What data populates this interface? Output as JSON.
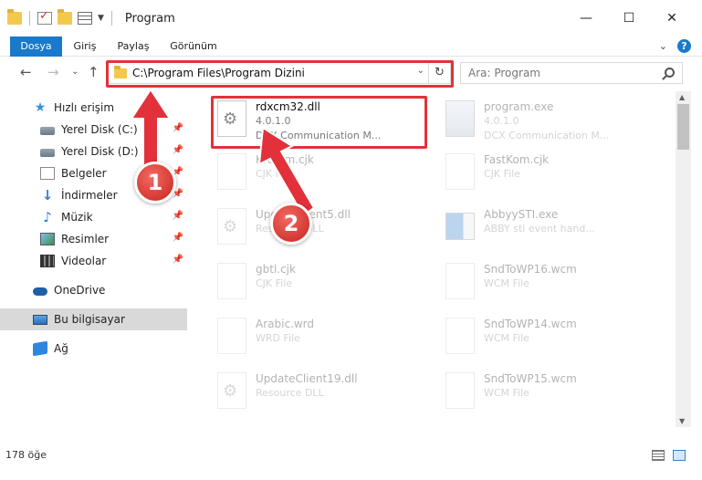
{
  "window": {
    "title": "Program",
    "minimize": "—",
    "maximize": "☐",
    "close": "✕"
  },
  "ribbon": {
    "tabs": [
      "Dosya",
      "Giriş",
      "Paylaş",
      "Görünüm"
    ],
    "help": "?",
    "collapse": "⌄"
  },
  "address": {
    "path": "C:\\Program Files\\Program Dizini",
    "dropdown": "⌄",
    "refresh": "↻",
    "back": "←",
    "forward": "→",
    "recent": "⌄",
    "up": "↑"
  },
  "search": {
    "placeholder": "Ara: Program"
  },
  "nav": {
    "items": [
      {
        "label": "Hızlı erişim",
        "icon": "star-icon"
      },
      {
        "label": "Yerel Disk (C:)",
        "icon": "disk-icon",
        "pinned": true
      },
      {
        "label": "Yerel Disk (D:)",
        "icon": "disk-icon",
        "pinned": true
      },
      {
        "label": "Belgeler",
        "icon": "documents-icon",
        "pinned": true
      },
      {
        "label": "İndirmeler",
        "icon": "downloads-icon",
        "pinned": true
      },
      {
        "label": "Müzik",
        "icon": "music-icon",
        "pinned": true
      },
      {
        "label": "Resimler",
        "icon": "pictures-icon",
        "pinned": true
      },
      {
        "label": "Videolar",
        "icon": "videos-icon",
        "pinned": true
      },
      {
        "label": "OneDrive",
        "icon": "onedrive-icon"
      },
      {
        "label": "Bu bilgisayar",
        "icon": "this-pc-icon",
        "selected": true
      },
      {
        "label": "Ağ",
        "icon": "network-icon"
      }
    ],
    "pin_glyph": "📌"
  },
  "files": [
    {
      "name": "rdxcm32.dll",
      "line1": "4.0.1.0",
      "line2": "DCX Communication M...",
      "icon": "dll-gear-icon",
      "highlighted": true
    },
    {
      "name": "program.exe",
      "line1": "4.0.1.0",
      "line2": "DCX Communication M...",
      "icon": "exe-icon"
    },
    {
      "name": "Krtcom.cjk",
      "line1": "CJK File",
      "line2": "",
      "icon": "file-icon"
    },
    {
      "name": "FastKom.cjk",
      "line1": "CJK File",
      "line2": "",
      "icon": "file-icon"
    },
    {
      "name": "UpdateClient5.dll",
      "line1": "Resource DLL",
      "line2": "",
      "icon": "dll-gear-icon"
    },
    {
      "name": "AbbyySTI.exe",
      "line1": "ABBY sti event hand...",
      "line2": "",
      "icon": "app-icon"
    },
    {
      "name": "gbtl.cjk",
      "line1": "CJK File",
      "line2": "",
      "icon": "file-icon"
    },
    {
      "name": "SndToWP16.wcm",
      "line1": "WCM File",
      "line2": "",
      "icon": "file-icon"
    },
    {
      "name": "Arabic.wrd",
      "line1": "WRD File",
      "line2": "",
      "icon": "file-icon"
    },
    {
      "name": "SndToWP14.wcm",
      "line1": "WCM File",
      "line2": "",
      "icon": "file-icon"
    },
    {
      "name": "UpdateClient19.dll",
      "line1": "Resource DLL",
      "line2": "",
      "icon": "dll-gear-icon"
    },
    {
      "name": "SndToWP15.wcm",
      "line1": "WCM File",
      "line2": "",
      "icon": "file-icon"
    }
  ],
  "status": {
    "count": "178 öğe"
  },
  "annotations": {
    "badge1": "1",
    "badge2": "2",
    "color": "#e2313a"
  }
}
